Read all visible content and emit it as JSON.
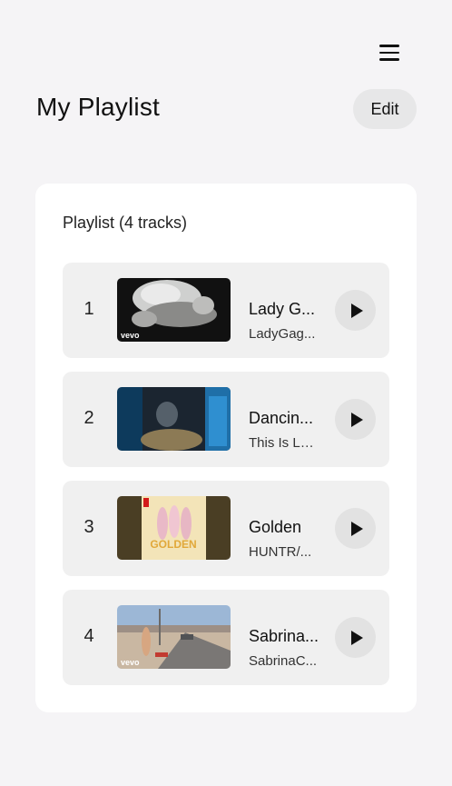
{
  "header": {
    "menu_icon": "hamburger-menu-icon",
    "title": "My Playlist",
    "edit_label": "Edit"
  },
  "playlist": {
    "heading": "Playlist (4 tracks)",
    "tracks": [
      {
        "number": "1",
        "title": "Lady G...",
        "artist": "LadyGag...",
        "thumbnail_badge": "vevo",
        "play_icon": "play-icon"
      },
      {
        "number": "2",
        "title": "Dancin...",
        "artist": "This Is Lo...",
        "thumbnail_badge": "",
        "play_icon": "play-icon"
      },
      {
        "number": "3",
        "title": "Golden",
        "artist": "HUNTR/...",
        "thumbnail_badge": "GOLDEN",
        "play_icon": "play-icon"
      },
      {
        "number": "4",
        "title": "Sabrina...",
        "artist": "SabrinaC...",
        "thumbnail_badge": "vevo",
        "play_icon": "play-icon"
      }
    ]
  },
  "colors": {
    "background": "#f5f4f6",
    "card": "#ffffff",
    "track_row": "#f0f0f0",
    "button": "#e7e7e8",
    "text": "#111111"
  }
}
